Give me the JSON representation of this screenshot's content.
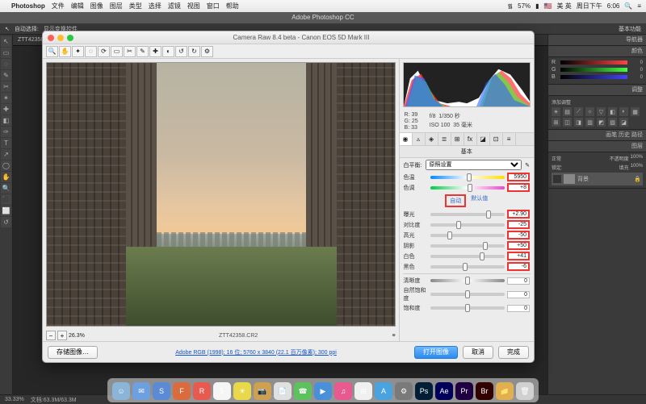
{
  "mac_menu": {
    "app": "Photoshop",
    "items": [
      "文件",
      "编辑",
      "图像",
      "图层",
      "类型",
      "选择",
      "滤镜",
      "视图",
      "窗口",
      "帮助"
    ],
    "right": {
      "battery": "57%",
      "flag": "🇺🇸",
      "ime": "美 英",
      "day": "周日下午",
      "time": "6:06"
    }
  },
  "ps": {
    "title": "Adobe Photoshop CC",
    "optbar_left": "自动选择:",
    "optbar_label2": "显示变换控件",
    "workspace": "基本功能",
    "tab": "ZTT42358",
    "tools": [
      "↖",
      "▭",
      "◌",
      "✎",
      "✂",
      "✴",
      "✚",
      "◧",
      "✑",
      "T",
      "↗",
      "◯",
      "✋",
      "🔍",
      "⬛",
      "⬜",
      "↺"
    ],
    "panel_titles": {
      "nav": "导航器",
      "color": "颜色",
      "adjust": "调整",
      "adj_sub": "添加调整",
      "hist": "画笔  历史  路径",
      "layers": "图层"
    },
    "rgb": {
      "r": "R",
      "g": "G",
      "b": "B",
      "val": "0"
    },
    "layers": {
      "normal": "正常",
      "opacity_lbl": "不透明度",
      "opacity": "100%",
      "fill_lbl": "填充",
      "fill": "100%",
      "lock": "锁定:",
      "bg": "背景"
    },
    "status": {
      "zoom": "33.33%",
      "doc": "文档:63.3M/63.3M"
    }
  },
  "cr": {
    "title": "Camera Raw 8.4 beta  -  Canon EOS 5D Mark III",
    "toolbar": [
      "🔍",
      "✋",
      "✦",
      "◌",
      "⟳",
      "▭",
      "✂",
      "✎",
      "✚",
      "◐",
      "↺",
      "↻",
      "⚙"
    ],
    "zoom": "26.3%",
    "filename": "ZTT42358.CR2",
    "info": {
      "r": "R:",
      "g": "G:",
      "b": "B:",
      "rv": "39",
      "gv": "25",
      "bv": "33",
      "fnum": "f/8",
      "shutter": "1/350 秒",
      "iso": "ISO 100",
      "focal": "35 毫米"
    },
    "tabs": [
      "◉",
      "▵",
      "◈",
      "≣",
      "⊞",
      "fx",
      "◪",
      "⊡",
      "≡"
    ],
    "panel_name": "基本",
    "wb_label": "白平衡:",
    "wb_value": "原照设置",
    "sliders": [
      {
        "label": "色温",
        "value": "5950",
        "pos": 52,
        "track": "rainbow",
        "hl": true
      },
      {
        "label": "色调",
        "value": "+8",
        "pos": 54,
        "track": "tint",
        "hl": true
      }
    ],
    "auto": "自动",
    "default": "默认值",
    "sliders2": [
      {
        "label": "曝光",
        "value": "+2.90",
        "pos": 78,
        "hl": true
      },
      {
        "label": "对比度",
        "value": "-25",
        "pos": 38,
        "hl": true
      },
      {
        "label": "高光",
        "value": "-50",
        "pos": 26,
        "hl": true
      },
      {
        "label": "阴影",
        "value": "+50",
        "pos": 74,
        "hl": true
      },
      {
        "label": "白色",
        "value": "+41",
        "pos": 70,
        "hl": true
      },
      {
        "label": "黑色",
        "value": "-6",
        "pos": 47,
        "hl": true
      }
    ],
    "sliders3": [
      {
        "label": "清晰度",
        "value": "0",
        "pos": 50,
        "track": "clarity"
      },
      {
        "label": "自然饱和度",
        "value": "0",
        "pos": 50
      },
      {
        "label": "饱和度",
        "value": "0",
        "pos": 50
      }
    ],
    "footer": {
      "save": "存储图像…",
      "link": "Adobe RGB (1998); 16 位; 5760 x 3840 (22.1 百万像素); 300 ppi",
      "open": "打开图像",
      "cancel": "取消",
      "done": "完成"
    }
  },
  "dock": [
    {
      "c": "#8ab4d8",
      "t": "☺"
    },
    {
      "c": "#6ea0e0",
      "t": "✉"
    },
    {
      "c": "#5b8bd4",
      "t": "S"
    },
    {
      "c": "#d96b3e",
      "t": "F"
    },
    {
      "c": "#e85a4f",
      "t": "R"
    },
    {
      "c": "#f5f5f5",
      "t": "5"
    },
    {
      "c": "#e8d84a",
      "t": "☀"
    },
    {
      "c": "#cfa050",
      "t": "📷"
    },
    {
      "c": "#e0e0e0",
      "t": "📄"
    },
    {
      "c": "#5dc15d",
      "t": "☎"
    },
    {
      "c": "#4a90d9",
      "t": "▶"
    },
    {
      "c": "#e85a8f",
      "t": "♫"
    },
    {
      "c": "#f0f0f0",
      "t": "⊞"
    },
    {
      "c": "#4aa3df",
      "t": "A"
    },
    {
      "c": "#7a7a7a",
      "t": "⚙"
    },
    {
      "c": "#001e36",
      "t": "Ps"
    },
    {
      "c": "#00005b",
      "t": "Ae"
    },
    {
      "c": "#1f0040",
      "t": "Pr"
    },
    {
      "c": "#330000",
      "t": "Br"
    },
    {
      "c": "#e0b050",
      "t": "📁"
    },
    {
      "c": "#d0d0d0",
      "t": "🗑"
    }
  ]
}
